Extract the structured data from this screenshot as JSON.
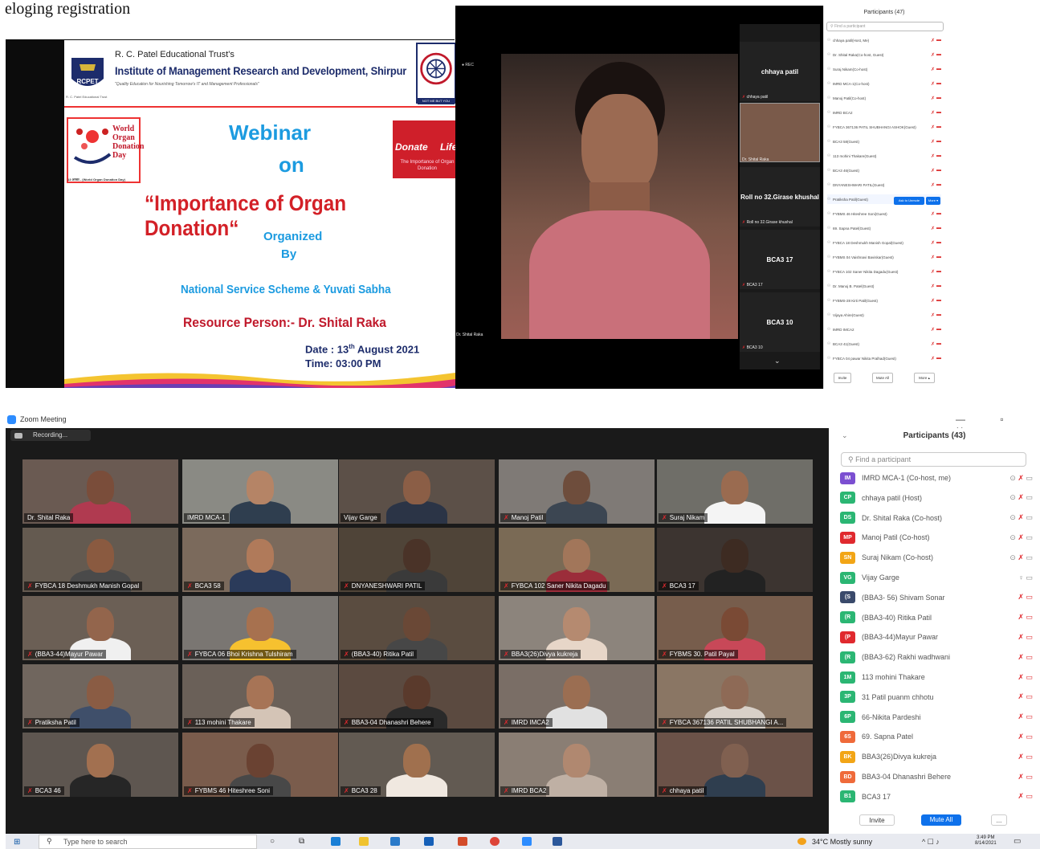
{
  "caption_text": "eloging registration",
  "poster": {
    "trust": "R. C. Patel Educational Trust's",
    "institute": "Institute of Management Research and Development, Shirpur",
    "tagline": "\"Quality Education for Nourishing Tomorrow's IT and Management Professionals\"",
    "logo_text": "RCPET",
    "logo_caption": "R. C. Patel Educational Trust",
    "nss_tag": "NOT ME BUT YOU",
    "od_title": "World Organ Donation Day",
    "od_caption": "13 अगस्त - (World Organ Donation Day)",
    "webinar": "Webinar",
    "on": "on",
    "dl_donate": "Donate",
    "dl_life": "Life",
    "dl_sub": "The Importance of Organ Donation",
    "title": "“Importance of Organ Donation“",
    "organized": "Organized",
    "by": "By",
    "organizers": "National Service Scheme  & Yuvati Sabha",
    "resource_person": "Resource Person:- Dr. Shital Raka",
    "date_prefix": "Date : 13",
    "date_sup": "th",
    "date_suffix": " August 2021",
    "time_label": "Time:",
    "time_value": " 03:00 PM"
  },
  "zoom_small": {
    "rec_label": "● REC",
    "speaker_name": "Dr. Shital Raka",
    "tiles": [
      {
        "label": "chhaya patil",
        "name": "chhaya patil"
      },
      {
        "label": "",
        "name": "Dr. Shital Raka"
      },
      {
        "label": "Roll no 32.Girase khushal",
        "name": "Roll no 32.Girase khushal"
      },
      {
        "label": "BCA3 17",
        "name": "BCA3 17"
      },
      {
        "label": "BCA3 10",
        "name": "BCA3 10"
      }
    ],
    "panel_title": "Participants (47)",
    "search_placeholder": "Find a participant",
    "rows": [
      "chhaya patil(Host, Me)",
      "Dr. Shital Raka(Co-host, Guest)",
      "Suraj Nikam(Co-host)",
      "IMRD MCA-1(Co-host)",
      "Manoj Patil(Co-host)",
      "IMRD BCA2",
      "FYBCA 367136 PATIL SHUBHANGI ASHOK(Guest)",
      "BCA3 58(Guest)",
      "113 mohini Thakare(Guest)",
      "BCA3 46(Guest)",
      "DNYANESHWARI PATIL(Guest)",
      "Pratiksha Patil(Guest)",
      "FYBMS 46 Hiteshree Soni(Guest)",
      "69. Sapna Patel(Guest)",
      "FYBCA 18 Deshmukh Manish Gopal(Guest)",
      "FYBMS 04 Vaishnavi Baviskar(Guest)",
      "FYBCA 102 Saner Nikita Dagadu(Guest)",
      "Dr. Manoj B. Patel(Guest)",
      "FYBMS-28 Kirti Patil(Guest)",
      "Vijaya Ahire(Guest)",
      "IMRD IMCA2",
      "BCA3 41(Guest)",
      "FYBCA 04 pawar Nikita Pralhad(Guest)"
    ],
    "ask_unmute": "Ask to Unmute",
    "more": "More ▾",
    "invite": "Invite",
    "mute_all": "Mute All",
    "footer_more": "More ▴"
  },
  "zoom_main": {
    "window_title": "Zoom Meeting",
    "window_controls": "— ▫ ✕",
    "recording": "Recording...",
    "tiles": [
      "Dr. Shital Raka",
      "IMRD MCA-1",
      "Vijay Garge",
      "Manoj Patil",
      "Suraj Nikam",
      "FYBCA 18 Deshmukh Manish Gopal",
      "BCA3 58",
      "DNYANESHWARI PATIL",
      "FYBCA 102 Saner Nikita Dagadu",
      "BCA3 17",
      "(BBA3-44)Mayur Pawar",
      "FYBCA 06 Bhoi Krishna Tulshiram",
      "(BBA3-40) Ritika Patil",
      "BBA3(26)Divya kukreja",
      "FYBMS 30. Patil Payal",
      "Pratiksha Patil",
      "113 mohini Thakare",
      "BBA3-04 Dhanashri Behere",
      "IMRD IMCA2",
      "FYBCA 367136 PATIL SHUBHANGI A...",
      "BCA3 46",
      "FYBMS 46 Hiteshree Soni",
      "BCA3 28",
      "IMRD BCA2",
      "chhaya patil"
    ],
    "panel_title": "Participants (43)",
    "search_placeholder": "Find a participant",
    "rows": [
      {
        "initials": "IM",
        "name": "IMRD MCA-1 (Co-host, me)",
        "color": "#7b4fd1"
      },
      {
        "initials": "CP",
        "name": "chhaya patil (Host)",
        "color": "#2bb673"
      },
      {
        "initials": "DS",
        "name": "Dr. Shital Raka (Co-host)",
        "color": "#2bb673"
      },
      {
        "initials": "MP",
        "name": "Manoj Patil (Co-host)",
        "color": "#e0292e"
      },
      {
        "initials": "SN",
        "name": "Suraj Nikam (Co-host)",
        "color": "#f2a516"
      },
      {
        "initials": "VG",
        "name": "Vijay Garge",
        "color": "#2bb673"
      },
      {
        "initials": "(S",
        "name": "(BBA3- 56) Shivam Sonar",
        "color": "#3a4a6b"
      },
      {
        "initials": "(R",
        "name": "(BBA3-40) Ritika Patil",
        "color": "#2bb673"
      },
      {
        "initials": "(P",
        "name": "(BBA3-44)Mayur Pawar",
        "color": "#e0292e"
      },
      {
        "initials": "(R",
        "name": "(BBA3-62) Rakhi wadhwani",
        "color": "#2bb673"
      },
      {
        "initials": "1M",
        "name": "113 mohini Thakare",
        "color": "#2bb673"
      },
      {
        "initials": "3P",
        "name": "31 Patil puanm chhotu",
        "color": "#2bb673"
      },
      {
        "initials": "6P",
        "name": "66-Nikita Pardeshi",
        "color": "#2bb673"
      },
      {
        "initials": "6S",
        "name": "69. Sapna Patel",
        "color": "#ef6a3a"
      },
      {
        "initials": "BK",
        "name": "BBA3(26)Divya kukreja",
        "color": "#f2a516"
      },
      {
        "initials": "BD",
        "name": "BBA3-04 Dhanashri Behere",
        "color": "#ef6a3a"
      },
      {
        "initials": "B1",
        "name": "BCA3 17",
        "color": "#2bb673"
      }
    ],
    "invite": "Invite",
    "mute_all": "Mute All",
    "more": "..."
  },
  "taskbar": {
    "search_placeholder": "Type here to search",
    "weather": "34°C  Mostly sunny",
    "time": "3:49 PM",
    "date": "8/14/2021"
  }
}
